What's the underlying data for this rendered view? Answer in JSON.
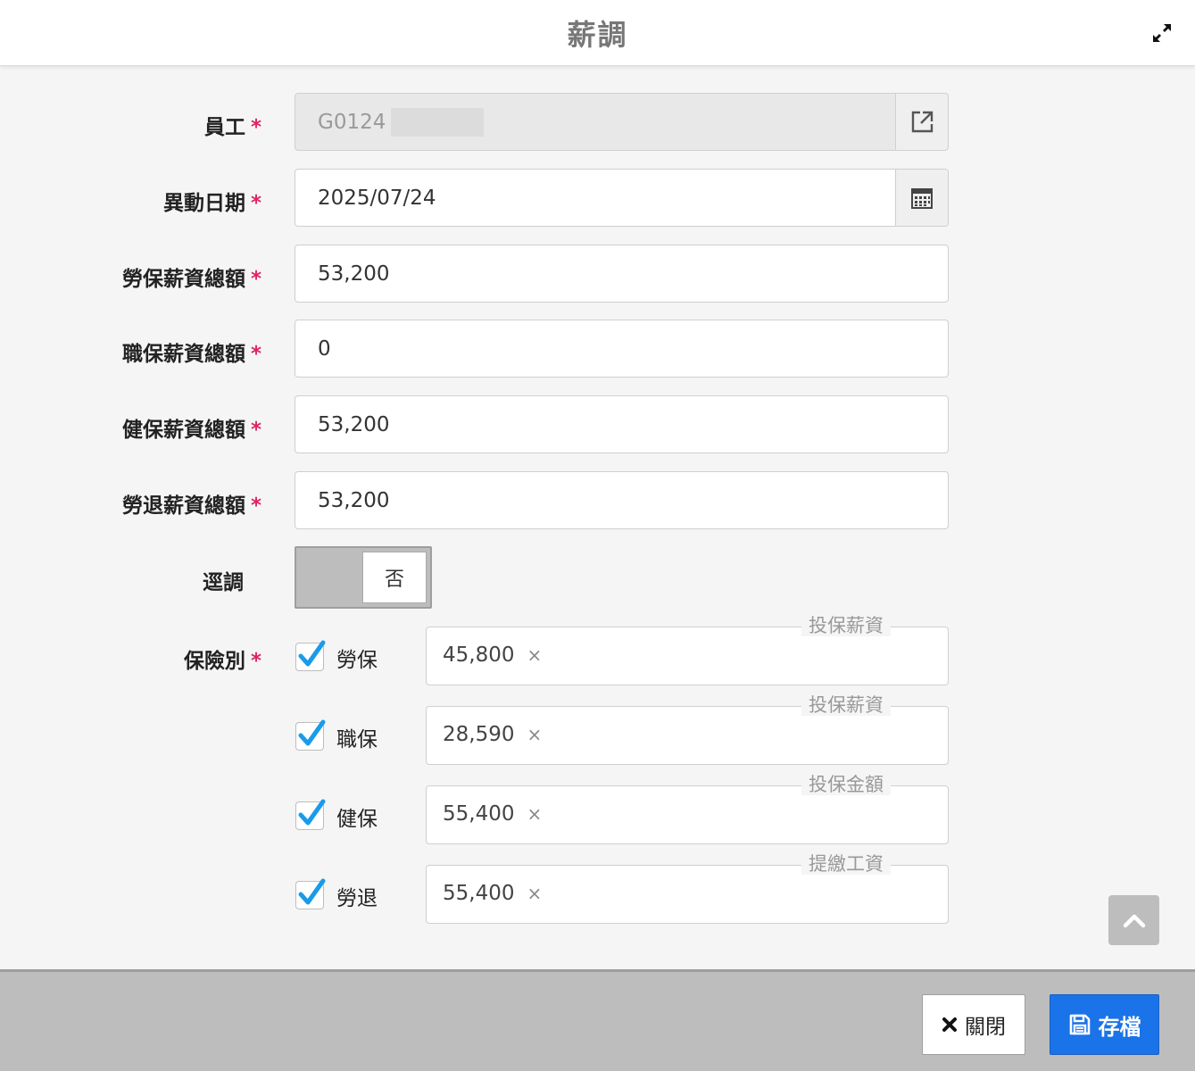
{
  "header": {
    "title": "薪調"
  },
  "form": {
    "employee": {
      "label": "員工",
      "value": "G0124"
    },
    "change_date": {
      "label": "異動日期",
      "value": "2025/07/24"
    },
    "labor_salary": {
      "label": "勞保薪資總額",
      "value": "53,200"
    },
    "occupational_salary": {
      "label": "職保薪資總額",
      "value": "0"
    },
    "health_salary": {
      "label": "健保薪資總額",
      "value": "53,200"
    },
    "pension_salary": {
      "label": "勞退薪資總額",
      "value": "53,200"
    },
    "backdated": {
      "label": "逕調",
      "value": "否"
    },
    "insurance": {
      "label": "保險別",
      "items": [
        {
          "name": "勞保",
          "checked": true,
          "legend": "投保薪資",
          "value": "45,800"
        },
        {
          "name": "職保",
          "checked": true,
          "legend": "投保薪資",
          "value": "28,590"
        },
        {
          "name": "健保",
          "checked": true,
          "legend": "投保金額",
          "value": "55,400"
        },
        {
          "name": "勞退",
          "checked": true,
          "legend": "提繳工資",
          "value": "55,400"
        }
      ]
    },
    "required_mark": "*",
    "remove_mark": "×"
  },
  "footer": {
    "close_label": "關閉",
    "save_label": "存檔"
  },
  "colors": {
    "accent": "#1a73e8",
    "required": "#e0245e",
    "check": "#1a9be8"
  }
}
